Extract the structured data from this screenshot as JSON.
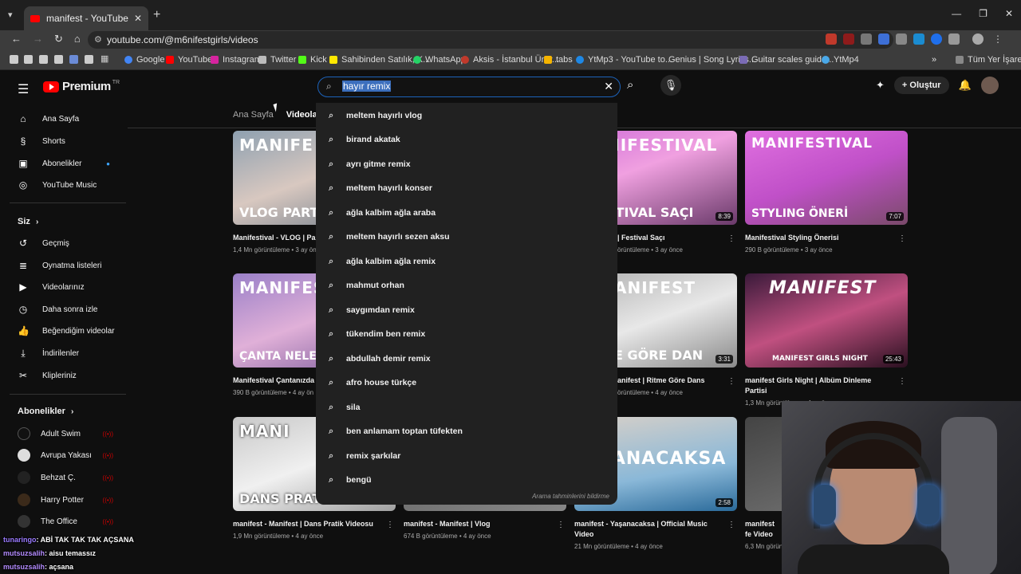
{
  "browser": {
    "tab_title": "manifest - YouTube",
    "url": "youtube.com/@m6nifestgirls/videos",
    "bookmarks": [
      "Google",
      "YouTube",
      "Instagram",
      "Twitter",
      "Kick",
      "Sahibinden Satılık, K...",
      "WhatsApp",
      "Aksis - İstanbul Üniv...",
      "tabs",
      "YtMp3 - YouTube to...",
      "Genius | Song Lyrics...",
      "Guitar scales guide...",
      "YtMp4",
      "Tüm Yer İşaretleri"
    ]
  },
  "header": {
    "logo": "Premium",
    "logo_sup": "TR",
    "search_query": "hayır remix",
    "create_label": "Oluştur"
  },
  "sidebar": {
    "main": [
      "Ana Sayfa",
      "Shorts",
      "Abonelikler",
      "YouTube Music"
    ],
    "you_heading": "Siz",
    "you_items": [
      "Geçmiş",
      "Oynatma listeleri",
      "Videolarınız",
      "Daha sonra izle",
      "Beğendiğim videolar",
      "İndirilenler",
      "Klipleriniz"
    ],
    "subs_heading": "Abonelikler",
    "subs": [
      "Adult Swim",
      "Avrupa Yakası",
      "Behzat Ç.",
      "Harry Potter",
      "The Office"
    ]
  },
  "channel_tabs": {
    "home": "Ana Sayfa",
    "videos": "Videolar"
  },
  "suggestions": [
    "meltem hayırlı vlog",
    "birand akatak",
    "ayrı gitme remix",
    "meltem hayırlı konser",
    "ağla kalbim ağla araba",
    "meltem hayırlı sezen aksu",
    "ağla kalbim ağla remix",
    "mahmut orhan",
    "saygımdan remix",
    "tükendim ben remix",
    "abdullah demir remix",
    "afro house türkçe",
    "sila",
    "ben anlamam toptan tüfekten",
    "remix şarkılar",
    "bengü"
  ],
  "suggestion_footer": "Arama tahminlerini bildirme",
  "videos": [
    {
      "title": "Manifestival - VLOG | Par",
      "meta": "1,4 Mn görüntüleme • 3 ay ön",
      "duration": "",
      "thumb_top": "MANIFE",
      "thumb_bottom": "VLOG PART 1"
    },
    {
      "title": "| Festival Saçı",
      "meta": "örüntüleme • 3 ay önce",
      "duration": "8:39",
      "thumb_top": "NIFESTIVAL",
      "thumb_bottom": "STIVAL SAÇI"
    },
    {
      "title": "Manifestival Styling Önerisi",
      "meta": "290 B görüntüleme • 3 ay önce",
      "duration": "7:07",
      "thumb_top": "MANIFESTIVAL",
      "thumb_bottom": "STYLING ÖNERİ"
    },
    {
      "title": "Manifestival Çantanızda",
      "meta": "390 B görüntüleme • 4 ay ön",
      "duration": "",
      "thumb_top": "MANIFEST",
      "thumb_bottom": "ÇANTA NELER O"
    },
    {
      "title": "anifest | Ritme Göre Dans",
      "meta": "örüntüleme • 4 ay önce",
      "duration": "3:31",
      "thumb_top": "ANIFEST",
      "thumb_bottom": "E GÖRE DAN"
    },
    {
      "title": "manifest Girls Night | Albüm Dinleme Partisi",
      "meta": "1,3 Mn görüntüleme • 4 ay önce",
      "duration": "25:43",
      "thumb_top": "MANIFEST",
      "thumb_bottom": "MANIFEST GIRLS NIGHT"
    },
    {
      "title": "manifest - Manifest | Dans Pratik Videosu",
      "meta": "1,9 Mn görüntüleme • 4 ay önce",
      "duration": "",
      "thumb_top": "MANI",
      "thumb_bottom": "DANS PRATİ"
    },
    {
      "title": "manifest - Manifest | Vlog",
      "meta": "674 B görüntüleme • 4 ay önce",
      "duration": "",
      "thumb_top": "",
      "thumb_bottom": ""
    },
    {
      "title": "manifest - Yaşanacaksa | Official Music Video",
      "meta": "21 Mn görüntüleme • 4 ay önce",
      "duration": "2:58",
      "thumb_top": "SANACAKSA",
      "thumb_bottom": ""
    },
    {
      "title": "manifest fe Video",
      "meta": "6,3 Mn görün",
      "duration": "",
      "thumb_top": "",
      "thumb_bottom": ""
    }
  ],
  "chat": [
    {
      "user": "tunaringo",
      "msg": ": ABİ TAK TAK TAK AÇSANA"
    },
    {
      "user": "mutsuzsalih",
      "msg": ": aisu temassız"
    },
    {
      "user": "mutsuzsalih",
      "msg": ": açsana"
    }
  ],
  "colors": {
    "accent_blue": "#1c62b9",
    "yt_red": "#ff0000",
    "bg": "#0f0f0f",
    "dropdown_bg": "#212121"
  }
}
